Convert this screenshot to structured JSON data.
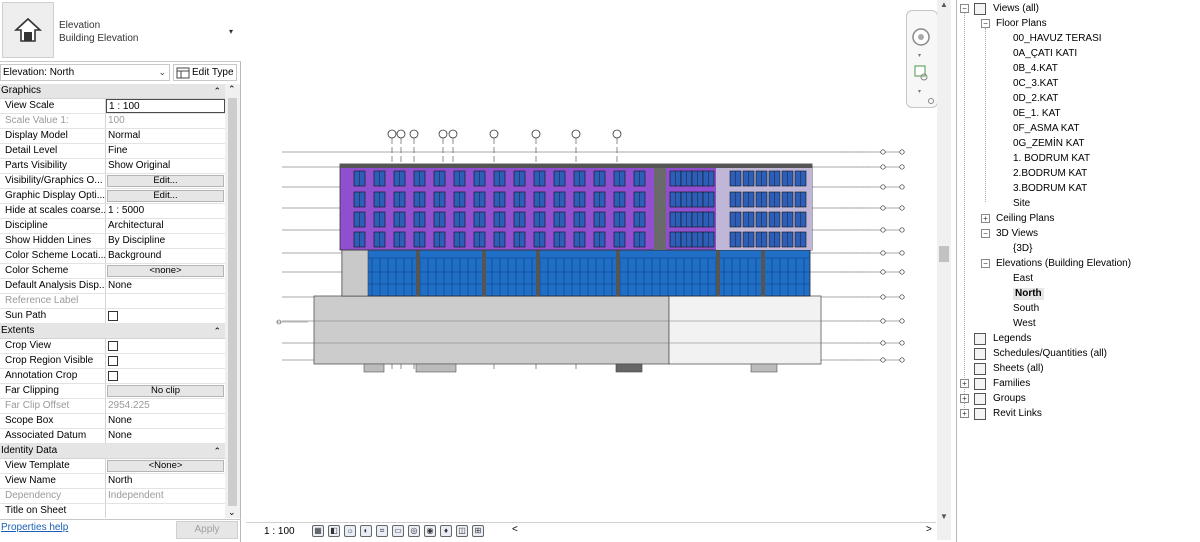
{
  "properties": {
    "type_family": "Elevation",
    "type_name": "Building Elevation",
    "instance_selector": "Elevation: North",
    "edit_type_label": "Edit Type",
    "groups": [
      {
        "name": "Graphics",
        "rows": [
          {
            "key": "View Scale",
            "value": "1 : 100",
            "kind": "boxed"
          },
          {
            "key": "Scale Value    1:",
            "value": "100",
            "kind": "dim"
          },
          {
            "key": "Display Model",
            "value": "Normal"
          },
          {
            "key": "Detail Level",
            "value": "Fine"
          },
          {
            "key": "Parts Visibility",
            "value": "Show Original"
          },
          {
            "key": "Visibility/Graphics O...",
            "value": "Edit...",
            "kind": "button"
          },
          {
            "key": "Graphic Display Opti...",
            "value": "Edit...",
            "kind": "button"
          },
          {
            "key": "Hide at scales coarse...",
            "value": "1 : 5000"
          },
          {
            "key": "Discipline",
            "value": "Architectural"
          },
          {
            "key": "Show Hidden Lines",
            "value": "By Discipline"
          },
          {
            "key": "Color Scheme Locati...",
            "value": "Background"
          },
          {
            "key": "Color Scheme",
            "value": "<none>",
            "kind": "button"
          },
          {
            "key": "Default Analysis Disp...",
            "value": "None"
          },
          {
            "key": "Reference Label",
            "value": "",
            "kind": "dim"
          },
          {
            "key": "Sun Path",
            "value": "",
            "kind": "check"
          }
        ]
      },
      {
        "name": "Extents",
        "rows": [
          {
            "key": "Crop View",
            "value": "",
            "kind": "check"
          },
          {
            "key": "Crop Region Visible",
            "value": "",
            "kind": "check"
          },
          {
            "key": "Annotation Crop",
            "value": "",
            "kind": "check"
          },
          {
            "key": "Far Clipping",
            "value": "No clip",
            "kind": "button"
          },
          {
            "key": "Far Clip Offset",
            "value": "2954.225",
            "kind": "dim"
          },
          {
            "key": "Scope Box",
            "value": "None"
          },
          {
            "key": "Associated Datum",
            "value": "None"
          }
        ]
      },
      {
        "name": "Identity Data",
        "rows": [
          {
            "key": "View Template",
            "value": "<None>",
            "kind": "button"
          },
          {
            "key": "View Name",
            "value": "North"
          },
          {
            "key": "Dependency",
            "value": "Independent",
            "kind": "dim"
          },
          {
            "key": "Title on Sheet",
            "value": ""
          }
        ]
      }
    ],
    "help_link": "Properties help",
    "apply_label": "Apply"
  },
  "viewbar": {
    "scale": "1 : 100"
  },
  "browser": {
    "root": "Views (all)",
    "floor_plans": "Floor Plans",
    "floor_plan_items": [
      "00_HAVUZ TERASI",
      "0A_ÇATI KATI",
      "0B_4.KAT",
      "0C_3.KAT",
      "0D_2.KAT",
      "0E_1. KAT",
      "0F_ASMA KAT",
      "0G_ZEMİN KAT",
      "1. BODRUM KAT",
      "2.BODRUM KAT",
      "3.BODRUM KAT",
      "Site"
    ],
    "ceiling_plans": "Ceiling Plans",
    "views_3d": "3D Views",
    "views_3d_items": [
      "{3D}"
    ],
    "elevations": "Elevations (Building Elevation)",
    "elevation_items": [
      "East",
      "North",
      "South",
      "West"
    ],
    "selected_elevation": "North",
    "other_nodes": [
      "Legends",
      "Schedules/Quantities (all)",
      "Sheets (all)",
      "Families",
      "Groups",
      "Revit Links"
    ]
  },
  "colors": {
    "facade_purple": "#9b59d6",
    "glass_blue": "#2a7fd4",
    "podium_gray": "#c8c8c8",
    "selection_gray": "#e6e6e6"
  }
}
